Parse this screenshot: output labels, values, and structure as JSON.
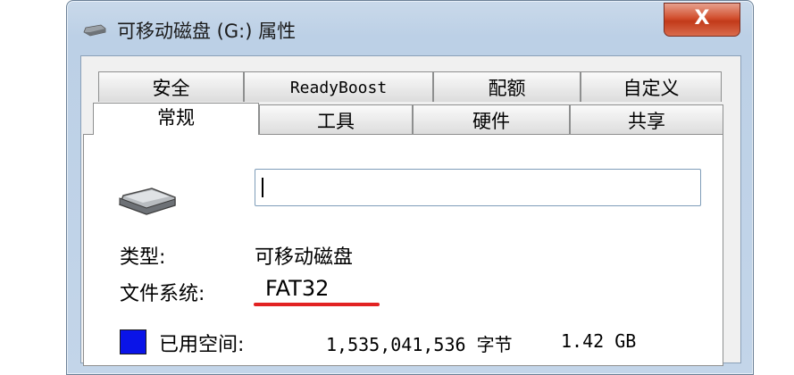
{
  "window": {
    "title": "可移动磁盘 (G:) 属性",
    "close_label": "X"
  },
  "tabs": {
    "row_back": [
      "安全",
      "ReadyBoost",
      "配额",
      "自定义"
    ],
    "row_front": [
      "常规",
      "工具",
      "硬件",
      "共享"
    ],
    "selected": "常规"
  },
  "general": {
    "name_value": "",
    "type_label": "类型:",
    "type_value": "可移动磁盘",
    "fs_label": "文件系统:",
    "fs_value": "FAT32",
    "used_label": "已用空间:",
    "used_bytes": "1,535,041,536 字节",
    "used_size": "1.42 GB",
    "used_color": "#0a14e8",
    "highlight_color": "#e22222"
  }
}
